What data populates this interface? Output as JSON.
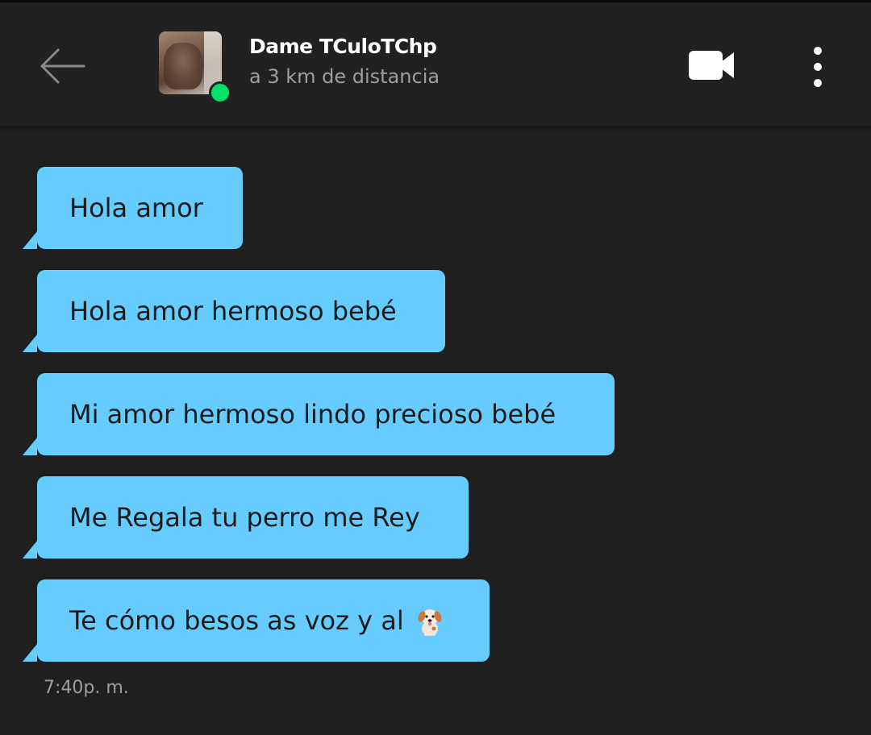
{
  "header": {
    "back_icon": "arrow-left-icon",
    "contact_name": "Dame TCuloTChp",
    "distance": "a 3 km de distancia",
    "online_color": "#00e06b",
    "video_icon": "video-camera-icon",
    "menu_icon": "more-vertical-icon"
  },
  "messages": [
    {
      "text": "Hola amor"
    },
    {
      "text": "Hola amor hermoso bebé"
    },
    {
      "text": "Mi amor hermoso lindo precioso bebé"
    },
    {
      "text": "Me Regala tu perro me Rey"
    },
    {
      "text": "Te cómo besos as voz y al",
      "emoji": "dog-face-icon"
    }
  ],
  "timestamp": "7:40p. m.",
  "colors": {
    "background": "#1f1f1f",
    "header": "#212121",
    "bubble": "#66ccfe",
    "bubble_text": "#1b1b1b",
    "secondary_text": "#9e9e9e"
  }
}
